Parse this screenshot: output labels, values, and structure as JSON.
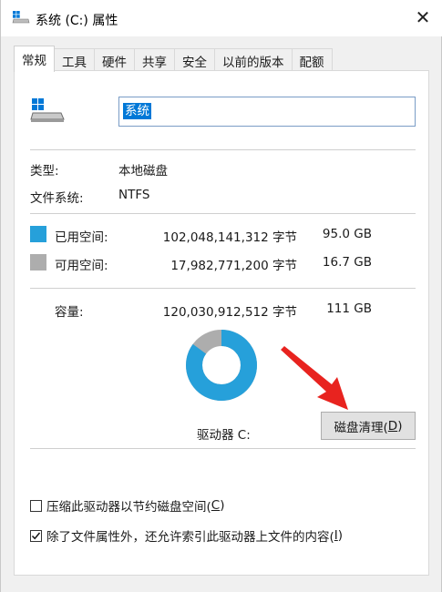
{
  "window": {
    "title": "系统 (C:) 属性",
    "close_glyph": "✕"
  },
  "tabs": [
    {
      "label": "常规",
      "active": true
    },
    {
      "label": "工具"
    },
    {
      "label": "硬件"
    },
    {
      "label": "共享"
    },
    {
      "label": "安全"
    },
    {
      "label": "以前的版本"
    },
    {
      "label": "配额"
    }
  ],
  "general": {
    "drive_name": "系统",
    "type_label": "类型:",
    "type_value": "本地磁盘",
    "fs_label": "文件系统:",
    "fs_value": "NTFS",
    "used": {
      "label": "已用空间:",
      "bytes": "102,048,141,312 字节",
      "size": "95.0 GB",
      "color": "#26a0da"
    },
    "free": {
      "label": "可用空间:",
      "bytes": "17,982,771,200 字节",
      "size": "16.7 GB",
      "color": "#adadad"
    },
    "capacity": {
      "label": "容量:",
      "bytes": "120,030,912,512 字节",
      "size": "111 GB"
    },
    "used_fraction": 0.85,
    "drive_label": "驱动器 C:",
    "cleanup_button": {
      "text": "磁盘清理(",
      "key": "D",
      "close": ")"
    },
    "compress": {
      "text": "压缩此驱动器以节约磁盘空间(",
      "key": "C",
      "close": ")",
      "checked": false
    },
    "index": {
      "text": "除了文件属性外，还允许索引此驱动器上文件的内容(",
      "key": "I",
      "close": ")",
      "checked": true
    }
  },
  "colors": {
    "arrow": "#e8231f",
    "accent": "#0078d7"
  }
}
